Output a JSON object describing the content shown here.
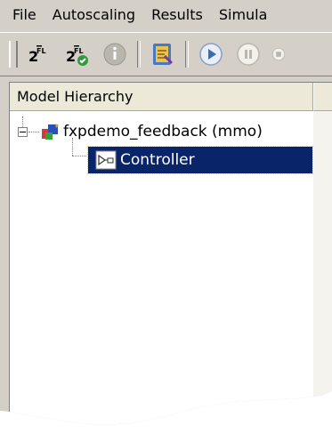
{
  "menubar": {
    "items": [
      "File",
      "Autoscaling",
      "Results",
      "Simula"
    ]
  },
  "toolbar": {
    "buttons": [
      {
        "name": "propose-fraction-length-icon",
        "label": "FL"
      },
      {
        "name": "apply-fraction-length-icon",
        "label": "FL"
      },
      {
        "name": "info-icon"
      },
      {
        "name": "model-explorer-icon"
      },
      {
        "name": "play-icon"
      },
      {
        "name": "pause-icon"
      },
      {
        "name": "stop-icon"
      }
    ]
  },
  "panel": {
    "header": "Model Hierarchy"
  },
  "tree": {
    "root": {
      "label": "fxpdemo_feedback (mmo)"
    },
    "child": {
      "label": "Controller"
    }
  },
  "colors": {
    "selection": "#0a246a",
    "chrome": "#d4d0c8",
    "accent": "#3a6ea5"
  }
}
